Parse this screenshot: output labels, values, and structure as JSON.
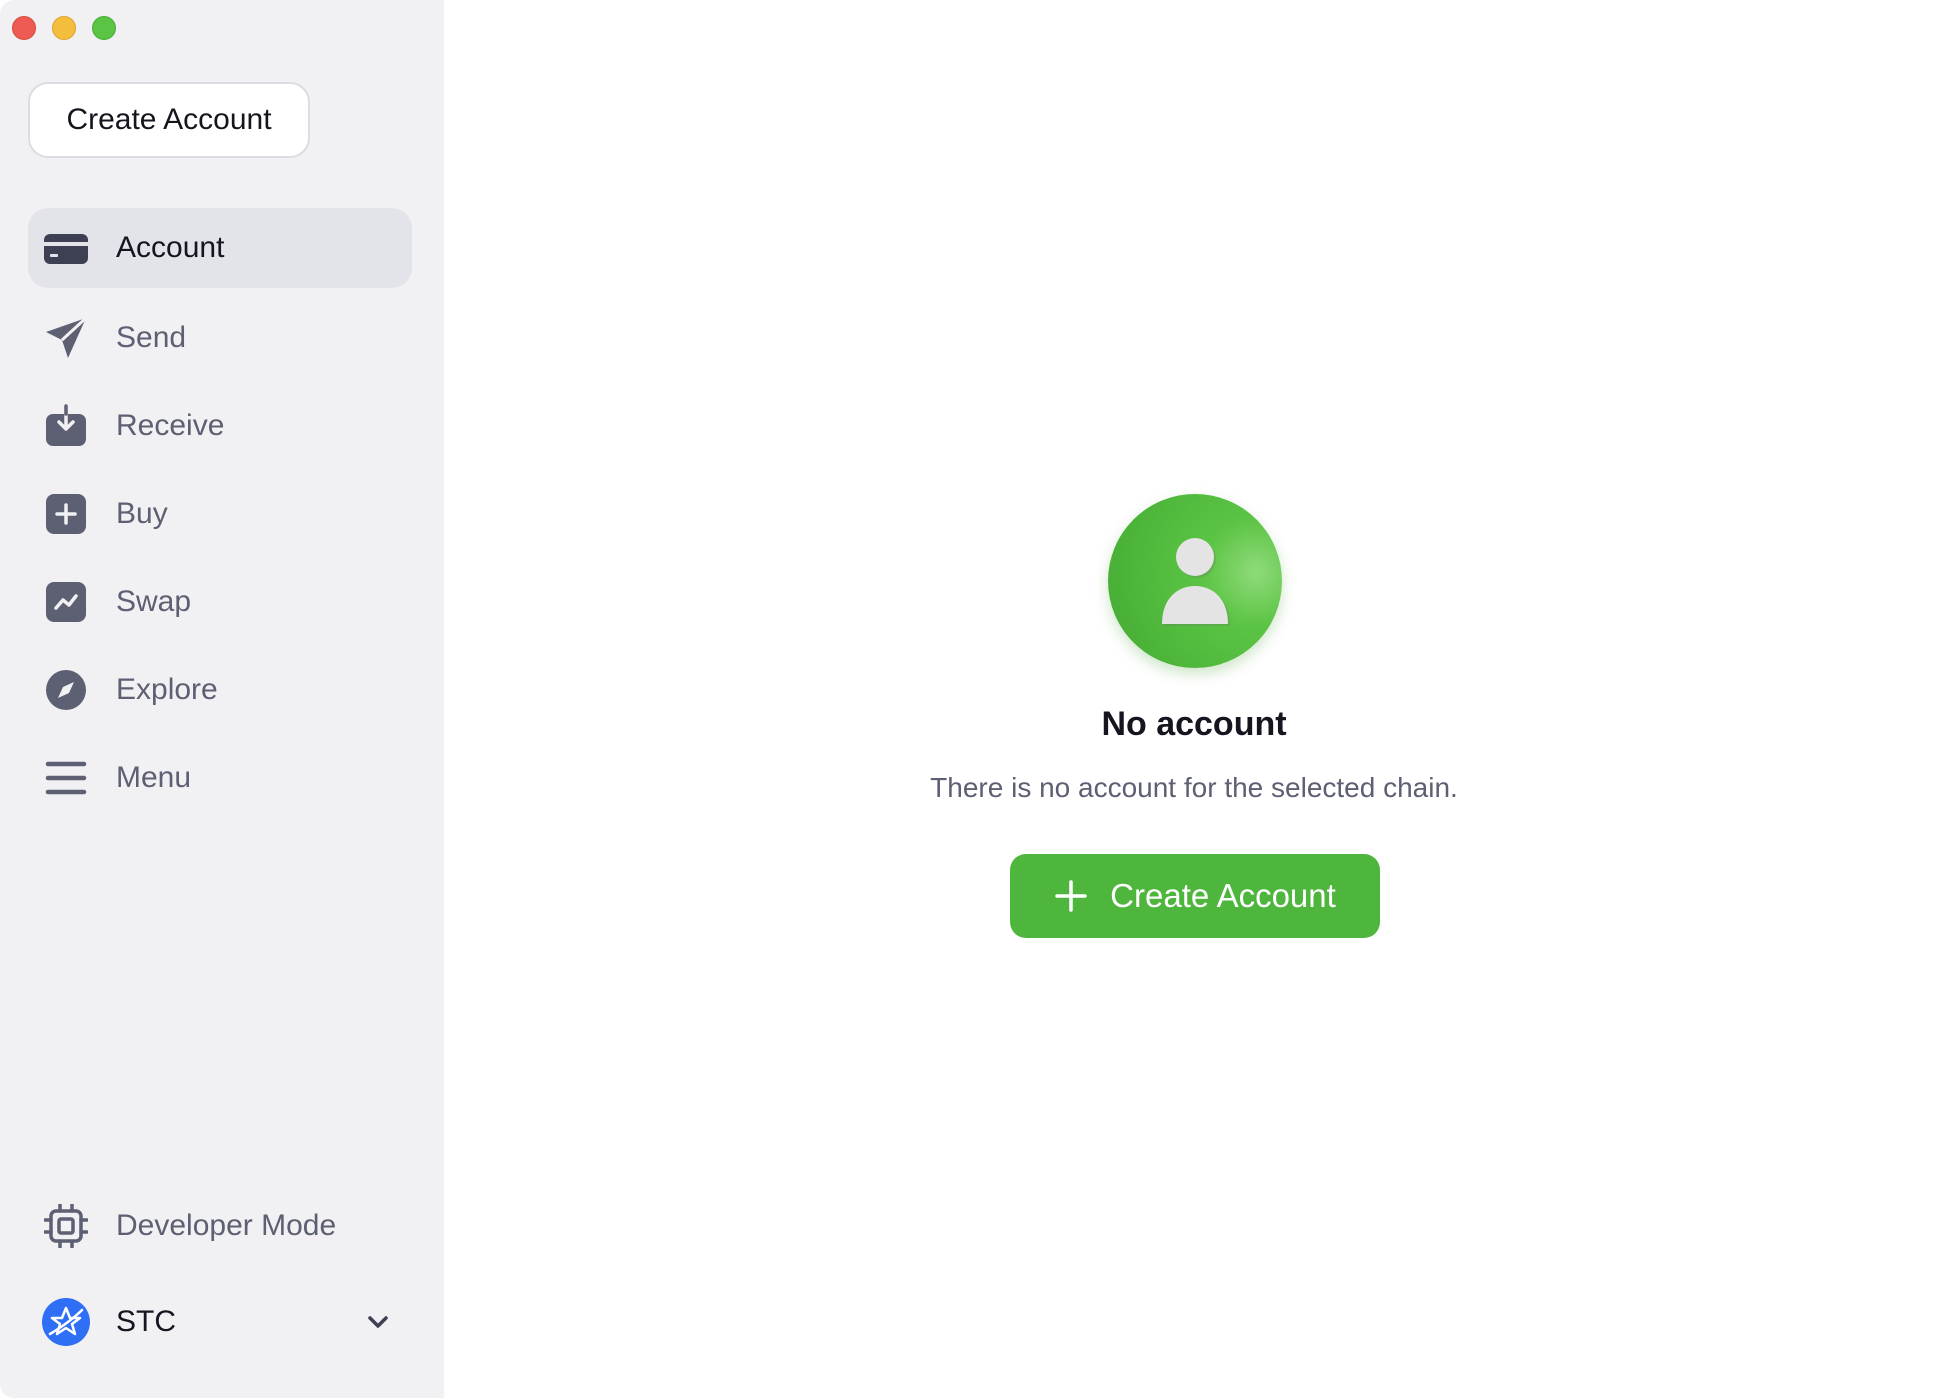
{
  "sidebar": {
    "create_button": "Create Account",
    "items": [
      {
        "label": "Account",
        "icon": "card-icon",
        "active": true
      },
      {
        "label": "Send",
        "icon": "paper-plane-icon"
      },
      {
        "label": "Receive",
        "icon": "download-tray-icon"
      },
      {
        "label": "Buy",
        "icon": "plus-square-icon"
      },
      {
        "label": "Swap",
        "icon": "chart-square-icon"
      },
      {
        "label": "Explore",
        "icon": "compass-icon"
      },
      {
        "label": "Menu",
        "icon": "hamburger-icon"
      }
    ],
    "developer_mode": "Developer Mode",
    "chain": {
      "label": "STC",
      "icon": "starcoin-logo-icon"
    }
  },
  "main": {
    "empty_title": "No account",
    "empty_description": "There is no account for the selected chain.",
    "create_button": "Create Account"
  },
  "colors": {
    "accent_green": "#4fb63d",
    "sidebar_bg": "#f1f1f4",
    "active_item_bg": "#e3e3ea",
    "icon_gray": "#5d5f72",
    "chain_blue": "#2f6ff5"
  }
}
